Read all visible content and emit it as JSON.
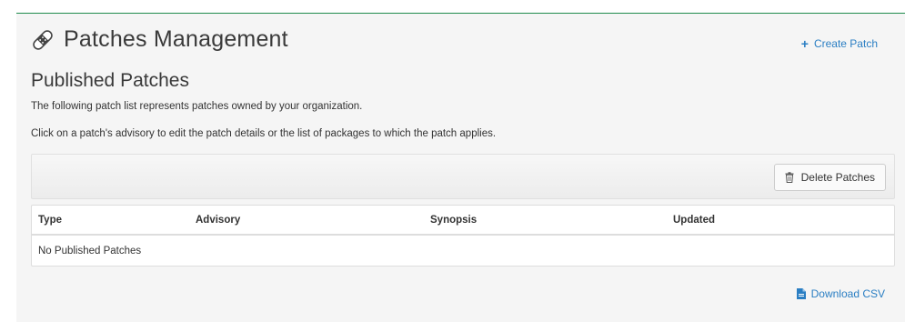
{
  "header": {
    "title": "Patches Management",
    "icon": "patch-bandage-icon",
    "create_label": "Create Patch"
  },
  "section": {
    "title": "Published Patches",
    "description_1": "The following patch list represents patches owned by your organization.",
    "description_2": "Click on a patch's advisory to edit the patch details or the list of packages to which the patch applies."
  },
  "toolbar": {
    "delete_label": "Delete Patches",
    "delete_icon": "trash-icon"
  },
  "table": {
    "columns": [
      "Type",
      "Advisory",
      "Synopsis",
      "Updated"
    ],
    "empty_message": "No Published Patches",
    "rows": []
  },
  "footer": {
    "download_label": "Download CSV",
    "download_icon": "file-csv-icon"
  },
  "colors": {
    "link": "#2a7ec3",
    "top_border": "#1f8a4c",
    "panel_bg": "#f5f5f5"
  }
}
